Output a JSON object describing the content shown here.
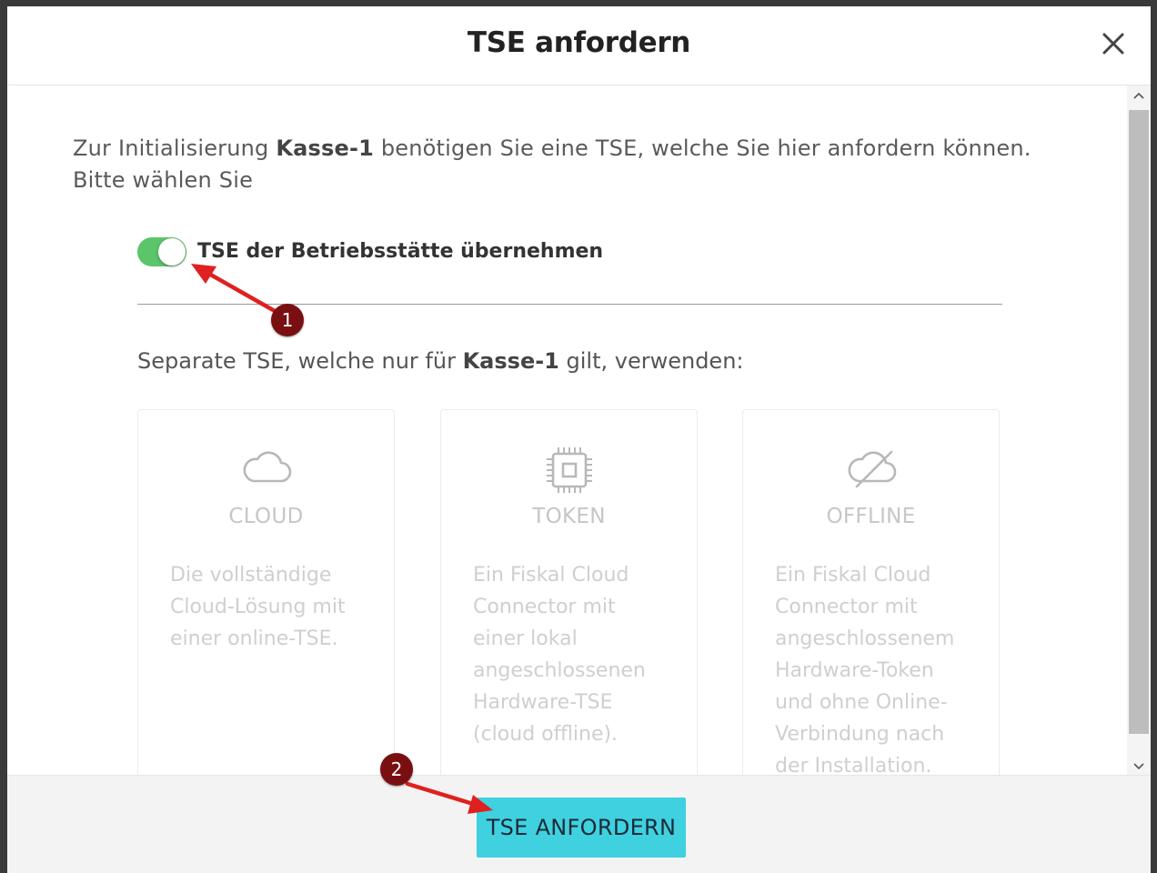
{
  "dialog": {
    "title": "TSE anfordern",
    "close_label": "×"
  },
  "intro": {
    "prefix": "Zur Initialisierung ",
    "register": "Kasse-1",
    "suffix": " benötigen Sie eine TSE, welche Sie hier anfordern können. Bitte wählen Sie"
  },
  "toggle": {
    "label": "TSE der Betriebsstätte übernehmen",
    "state": "on",
    "color": "#5cc56a"
  },
  "separate": {
    "prefix": "Separate TSE, welche nur für ",
    "register": "Kasse-1",
    "suffix": " gilt, verwenden:"
  },
  "options": [
    {
      "icon": "cloud-icon",
      "title": "CLOUD",
      "description": "Die vollständige Cloud-Lösung mit einer online-TSE."
    },
    {
      "icon": "chip-icon",
      "title": "TOKEN",
      "description": "Ein Fiskal Cloud Connector mit einer lokal angeschlossenen Hardware-TSE (cloud offline)."
    },
    {
      "icon": "cloud-off-icon",
      "title": "OFFLINE",
      "description": "Ein Fiskal Cloud Connector mit angeschlossenem Hardware-Token und ohne Online-Verbindung nach der Installation."
    }
  ],
  "footer": {
    "submit_label": "TSE ANFORDERN",
    "submit_color": "#3fd1df"
  },
  "annotations": {
    "badges": [
      "1",
      "2"
    ],
    "badge_color": "#7a0f12",
    "arrow_color": "#e02020"
  }
}
